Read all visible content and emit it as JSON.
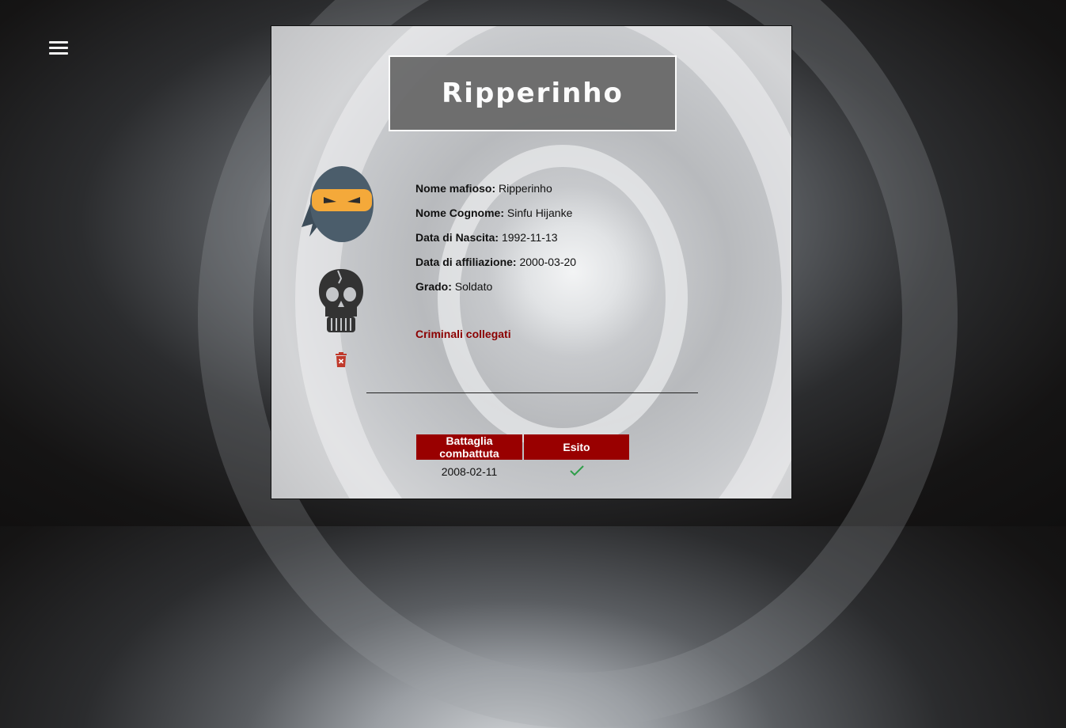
{
  "menu": {
    "icon": "hamburger-menu-icon"
  },
  "profile": {
    "title": "Ripperinho",
    "avatar_icon": "ninja-avatar-icon",
    "status_icon": "skull-icon",
    "delete_icon": "trash-icon",
    "fields": [
      {
        "label": "Nome mafioso:",
        "value": "Ripperinho"
      },
      {
        "label": "Nome Cognome:",
        "value": "Sinfu Hijanke"
      },
      {
        "label": "Data di Nascita:",
        "value": "1992-11-13"
      },
      {
        "label": "Data di affiliazione:",
        "value": "2000-03-20"
      },
      {
        "label": "Grado:",
        "value": "Soldato"
      }
    ],
    "linked_label": "Criminali collegati"
  },
  "battles": {
    "headers": [
      "Battaglia combattuta",
      "Esito"
    ],
    "rows": [
      {
        "date": "2008-02-11",
        "result_icon": "check-icon",
        "result_color": "#2e9e4a"
      }
    ]
  },
  "colors": {
    "accent": "#990000",
    "link": "#8b0000",
    "title_box": "#6a6a6a"
  }
}
